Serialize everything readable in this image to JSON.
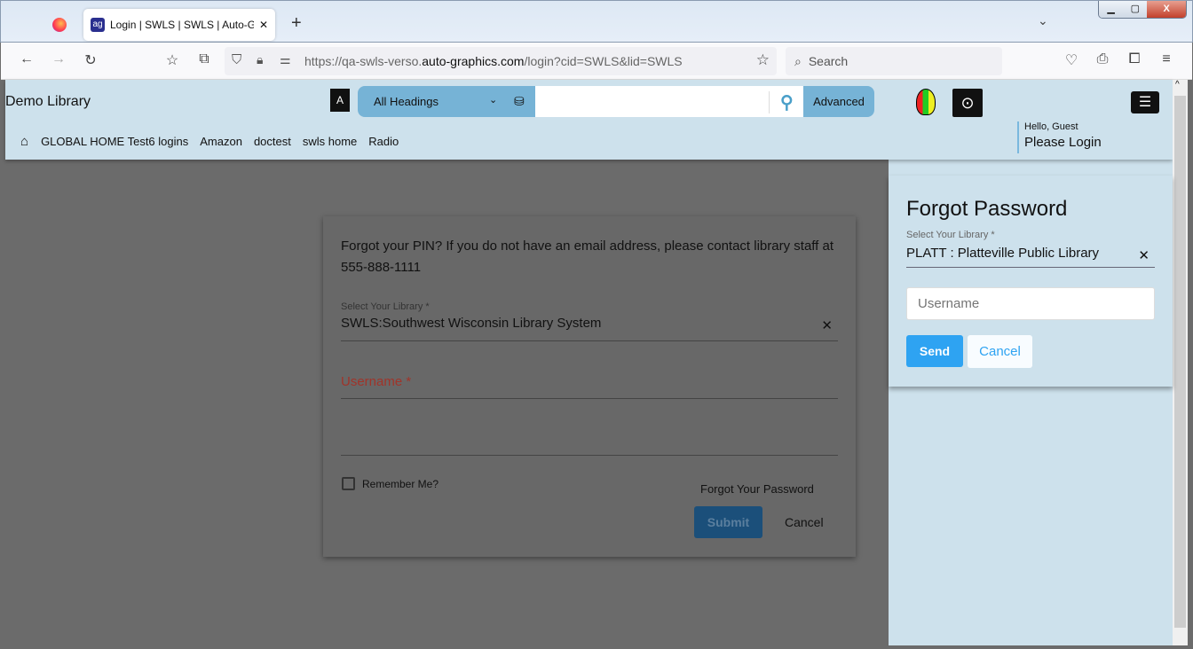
{
  "browser": {
    "tab_title": "Login | SWLS | SWLS | Auto-Gra",
    "url_prefix": "https://qa-swls-verso.",
    "url_domain": "auto-graphics.com",
    "url_suffix": "/login?cid=SWLS&lid=SWLS",
    "search_placeholder": "Search"
  },
  "header": {
    "library_name": "Demo Library",
    "search_scope": "All Headings",
    "advanced_label": "Advanced",
    "greeting": "Hello, Guest",
    "login_label": "Please Login",
    "nav": [
      "GLOBAL HOME Test6 logins",
      "Amazon",
      "doctest",
      "swls home",
      "Radio"
    ]
  },
  "login_card": {
    "message": "Forgot your PIN? If you do not have an email address, please contact library staff at 555-888-1111",
    "library_label": "Select Your Library *",
    "library_value": "SWLS:Southwest Wisconsin Library System",
    "username_label": "Username *",
    "remember_label": "Remember Me?",
    "forgot_label": "Forgot Your Password",
    "submit_label": "Submit",
    "cancel_label": "Cancel"
  },
  "forgot_panel": {
    "title": "Forgot Password",
    "library_label": "Select Your Library *",
    "library_value": "PLATT : Platteville Public Library",
    "username_placeholder": "Username",
    "send_label": "Send",
    "cancel_label": "Cancel"
  },
  "colors": {
    "header_bg": "#cde1ec",
    "search_blue": "#76b3d6",
    "send_blue": "#2ea3f2",
    "username_error": "#a0342a"
  }
}
